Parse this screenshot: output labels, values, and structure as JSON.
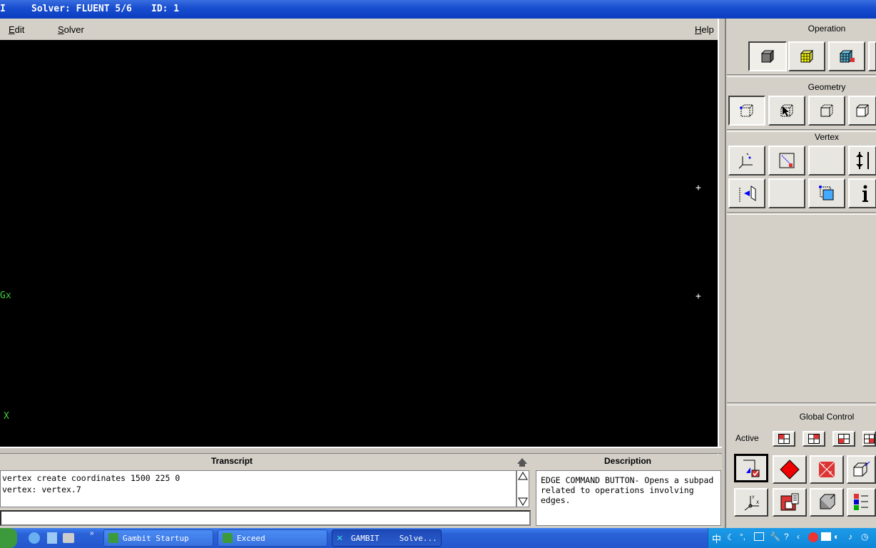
{
  "title_bar": {
    "solver": "Solver: FLUENT 5/6",
    "id": "ID: 1"
  },
  "menubar": {
    "edit": "Edit",
    "solver": "Solver",
    "help": "Help"
  },
  "graphics": {
    "axis_label_gx": "Gx",
    "axis_label_x": "X",
    "vertex_markers": [
      "+",
      "+"
    ]
  },
  "operation": {
    "title": "Operation",
    "buttons": [
      "geometry-cube-icon",
      "mesh-cube-icon",
      "zones-cube-icon"
    ]
  },
  "geometry": {
    "title": "Geometry",
    "buttons": [
      "vertex-command-icon",
      "edge-command-icon",
      "face-command-icon",
      "volume-command-icon"
    ]
  },
  "vertex": {
    "title": "Vertex",
    "buttons": [
      "create-vertex-icon",
      "move-copy-vertex-icon",
      "blank-button",
      "connect-vertices-icon",
      "project-vertex-icon",
      "blank-button",
      "modify-color-icon",
      "summarize-info-icon"
    ]
  },
  "global_control": {
    "title": "Global Control",
    "active_label": "Active",
    "buttons": [
      "fit-to-window-icon",
      "render-diamond-icon",
      "orient-model-icon",
      "view-cube-icon",
      "axis-coord-icon",
      "specify-display-icon",
      "render-shaded-icon",
      "color-legend-icon"
    ]
  },
  "transcript": {
    "title": "Transcript",
    "lines": [
      "vertex create coordinates 1500 225 0",
      "vertex: vertex.7"
    ],
    "command_value": ""
  },
  "description": {
    "title": "Description",
    "text": "EDGE COMMAND BUTTON- Opens a subpad related to operations involving edges."
  },
  "taskbar": {
    "tasks": [
      {
        "label": "Gambit Startup"
      },
      {
        "label": "Exceed"
      },
      {
        "label": "GAMBIT"
      },
      {
        "label": "Solve..."
      }
    ],
    "tray_text": "中"
  },
  "colors": {
    "graphics_bg": "#000000",
    "axis_green": "#3fce3f",
    "panel_bg": "#d4d0c8",
    "titlebar_blue": "#1a4fd0"
  }
}
